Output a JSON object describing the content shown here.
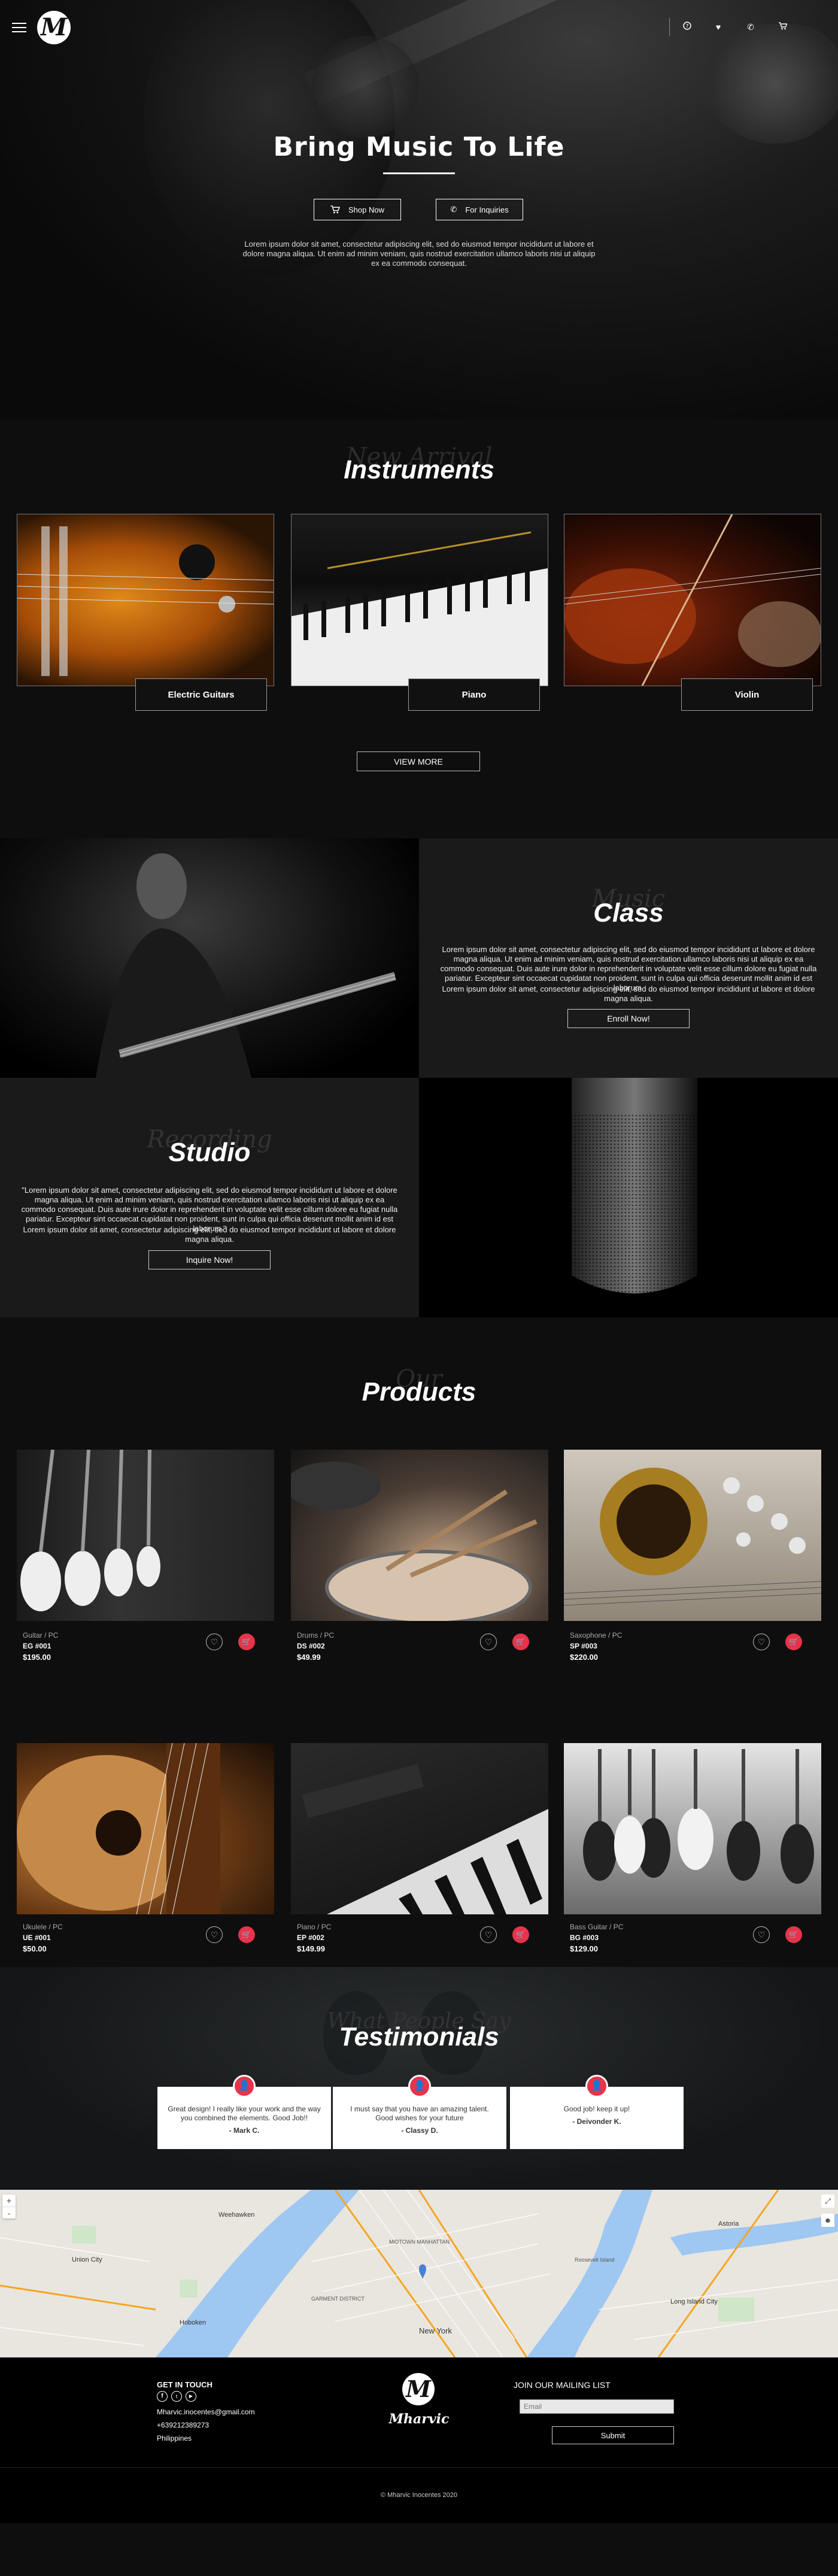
{
  "header": {
    "logo_letter": "M",
    "icons": [
      "help-icon",
      "heart-icon",
      "phone-icon",
      "cart-icon"
    ]
  },
  "hero": {
    "title": "Bring Music To Life",
    "shop_now": "Shop Now",
    "for_inquiries": "For Inquiries",
    "text": "Lorem ipsum dolor sit amet, consectetur adipiscing elit, sed do eiusmod tempor incididunt ut labore et dolore magna aliqua. Ut enim ad minim veniam, quis nostrud exercitation ullamco laboris nisi ut aliquip ex ea commodo consequat."
  },
  "instruments": {
    "script": "New Arrival",
    "title": "Instruments",
    "items": [
      {
        "label": "Electric Guitars"
      },
      {
        "label": "Piano"
      },
      {
        "label": "Violin"
      }
    ],
    "view_more": "VIEW MORE"
  },
  "class": {
    "script": "Music",
    "title": "Class",
    "text1": "Lorem ipsum dolor sit amet, consectetur adipiscing elit, sed do eiusmod tempor incididunt ut labore et dolore magna aliqua. Ut enim ad minim veniam, quis nostrud exercitation ullamco laboris nisi ut aliquip ex ea commodo consequat. Duis aute irure dolor in reprehenderit in voluptate velit esse cillum dolore eu fugiat nulla pariatur. Excepteur sint occaecat cupidatat non proident, sunt in culpa qui officia deserunt mollit anim id est laborum.",
    "text2": "Lorem ipsum dolor sit amet, consectetur adipiscing elit, sed do eiusmod tempor incididunt ut labore et dolore magna aliqua.",
    "button": "Enroll Now!"
  },
  "studio": {
    "script": "Recording",
    "title": "Studio",
    "text1": "\"Lorem ipsum dolor sit amet, consectetur adipiscing elit, sed do eiusmod tempor incididunt ut labore et dolore magna aliqua. Ut enim ad minim veniam, quis nostrud exercitation ullamco laboris nisi ut aliquip ex ea commodo consequat. Duis aute irure dolor in reprehenderit in voluptate velit esse cillum dolore eu fugiat nulla pariatur. Excepteur sint occaecat cupidatat non proident, sunt in culpa qui officia deserunt mollit anim id est laborum.\"",
    "text2": "Lorem ipsum dolor sit amet, consectetur adipiscing elit, sed do eiusmod tempor incididunt ut labore et dolore magna aliqua.",
    "button": "Inquire Now!"
  },
  "products": {
    "script": "Our",
    "title": "Products",
    "items": [
      {
        "category": "Guitar / PC",
        "code": "EG #001",
        "price": "$195.00"
      },
      {
        "category": "Drums / PC",
        "code": "DS #002",
        "price": "$49.99"
      },
      {
        "category": "Saxophone / PC",
        "code": "SP #003",
        "price": "$220.00"
      },
      {
        "category": "Ukulele / PC",
        "code": "UE #001",
        "price": "$50.00"
      },
      {
        "category": "Piano / PC",
        "code": "EP #002",
        "price": "$149.99"
      },
      {
        "category": "Bass Guitar / PC",
        "code": "BG #003",
        "price": "$129.00"
      }
    ]
  },
  "testimonials": {
    "script": "What People Say",
    "title": "Testimonials",
    "items": [
      {
        "quote": "Great design! I really like your work and the way you combined the elements. Good Job!!",
        "author": "- Mark C."
      },
      {
        "quote": "I must say that you have an amazing talent. Good wishes for your future",
        "author": "- Classy D."
      },
      {
        "quote": "Good job! keep it up!",
        "author": "- Deivonder K."
      }
    ]
  },
  "map": {
    "labels": [
      "Weehawken",
      "Hoboken",
      "MIDTOWN MANHATTAN",
      "GARMENT DISTRICT",
      "New York",
      "Long Island City",
      "Astoria",
      "Union City",
      "Roosevelt Island"
    ],
    "zoom_in": "+",
    "zoom_out": "-"
  },
  "footer": {
    "get_in_touch": "GET IN TOUCH",
    "email": "Mharvic.inocentes@gmail.com",
    "phone": "+639212389273",
    "country": "Philippines",
    "brand": "Mharvic",
    "mailing_title": "JOIN OUR MAILING LIST",
    "email_placeholder": "Email",
    "submit": "Submit",
    "social": [
      "facebook-icon",
      "twitter-icon",
      "youtube-icon"
    ]
  },
  "copyright": "© Mharvic Inocentes 2020"
}
